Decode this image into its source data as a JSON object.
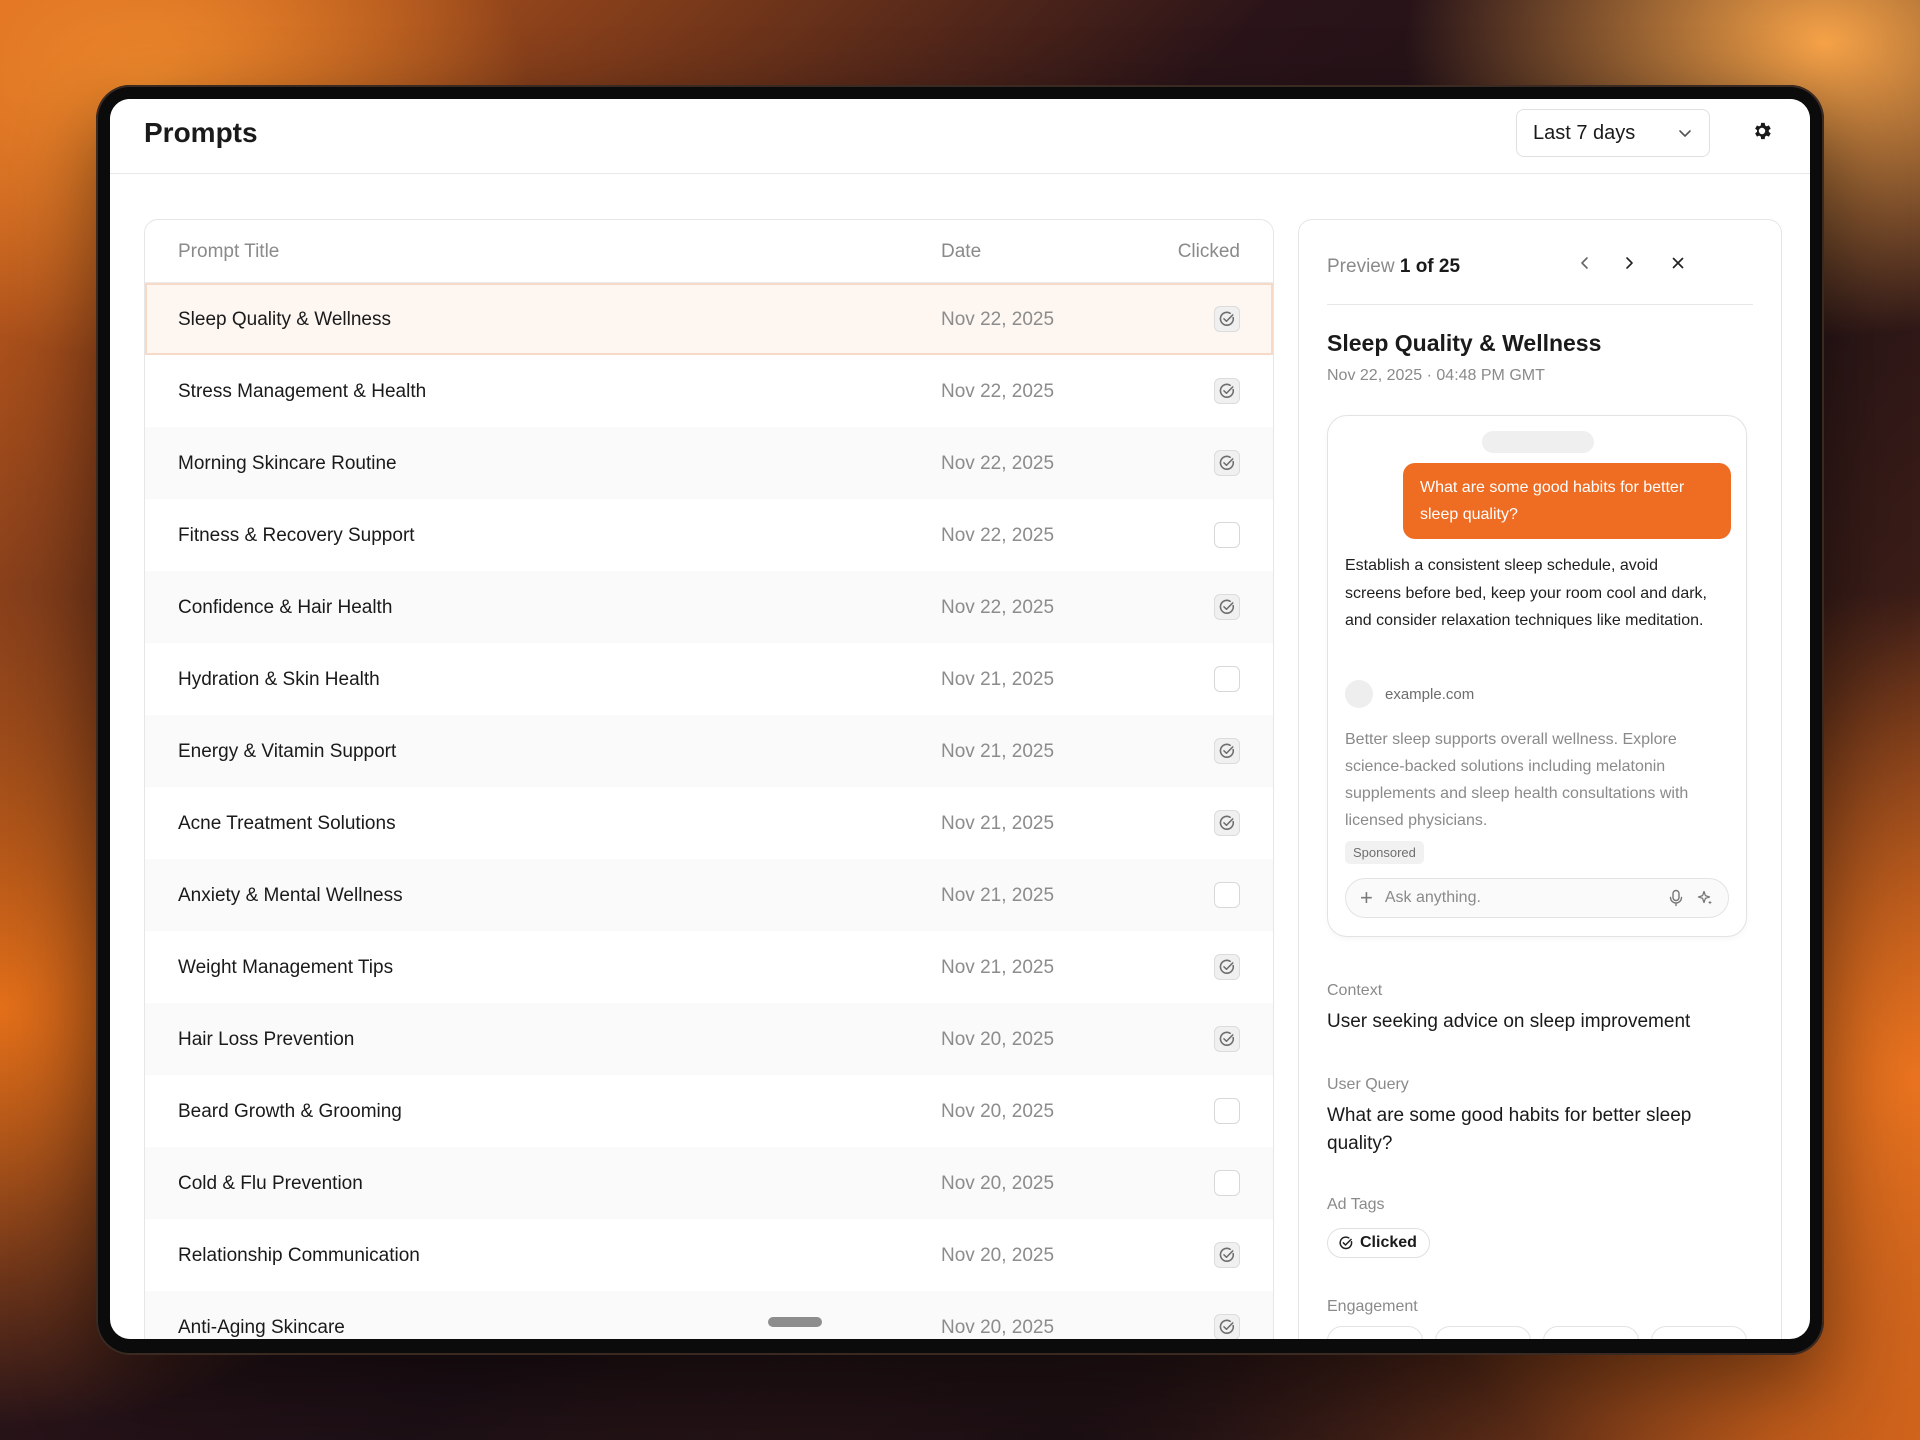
{
  "header": {
    "title": "Prompts",
    "range_label": "Last 7 days"
  },
  "table": {
    "columns": {
      "title": "Prompt Title",
      "date": "Date",
      "clicked": "Clicked"
    },
    "rows": [
      {
        "title": "Sleep Quality & Wellness",
        "date": "Nov 22, 2025",
        "clicked": true
      },
      {
        "title": "Stress Management & Health",
        "date": "Nov 22, 2025",
        "clicked": true
      },
      {
        "title": "Morning Skincare Routine",
        "date": "Nov 22, 2025",
        "clicked": true
      },
      {
        "title": "Fitness & Recovery Support",
        "date": "Nov 22, 2025",
        "clicked": false
      },
      {
        "title": "Confidence & Hair Health",
        "date": "Nov 22, 2025",
        "clicked": true
      },
      {
        "title": "Hydration & Skin Health",
        "date": "Nov 21, 2025",
        "clicked": false
      },
      {
        "title": "Energy & Vitamin Support",
        "date": "Nov 21, 2025",
        "clicked": true
      },
      {
        "title": "Acne Treatment Solutions",
        "date": "Nov 21, 2025",
        "clicked": true
      },
      {
        "title": "Anxiety & Mental Wellness",
        "date": "Nov 21, 2025",
        "clicked": false
      },
      {
        "title": "Weight Management Tips",
        "date": "Nov 21, 2025",
        "clicked": true
      },
      {
        "title": "Hair Loss Prevention",
        "date": "Nov 20, 2025",
        "clicked": true
      },
      {
        "title": "Beard Growth & Grooming",
        "date": "Nov 20, 2025",
        "clicked": false
      },
      {
        "title": "Cold & Flu Prevention",
        "date": "Nov 20, 2025",
        "clicked": false
      },
      {
        "title": "Relationship Communication",
        "date": "Nov 20, 2025",
        "clicked": true
      },
      {
        "title": "Anti-Aging Skincare",
        "date": "Nov 20, 2025",
        "clicked": true
      }
    ]
  },
  "preview": {
    "label": "Preview",
    "position": "1 of 25",
    "title": "Sleep Quality & Wellness",
    "datetime": "Nov 22, 2025 · 04:48 PM GMT",
    "chat": {
      "user_message": "What are some good habits for better sleep quality?",
      "answer": "Establish a consistent sleep schedule, avoid screens before bed, keep your room cool and dark, and consider relaxation techniques like meditation.",
      "source": "example.com",
      "sponsored_text": "Better sleep supports overall wellness. Explore science-backed solutions including melatonin supplements and sleep health consultations with licensed physicians.",
      "sponsored_badge": "Sponsored",
      "input_placeholder": "Ask anything."
    },
    "context_label": "Context",
    "context_value": "User seeking advice on sleep improvement",
    "query_label": "User Query",
    "query_value": "What are some good habits for better sleep quality?",
    "tags_label": "Ad Tags",
    "tag_clicked": "Clicked",
    "engagement_label": "Engagement"
  },
  "colors": {
    "accent": "#ef6c23",
    "selected_row_bg": "#fdf6f1"
  },
  "icons": {
    "range_select": "chevron-down-icon",
    "settings": "gear-icon",
    "prev": "chevron-left-icon",
    "next": "chevron-right-icon",
    "close": "close-icon",
    "clicked": "check-circle-icon",
    "add": "plus-icon",
    "mic": "microphone-icon",
    "sparkle": "sparkle-icon"
  }
}
